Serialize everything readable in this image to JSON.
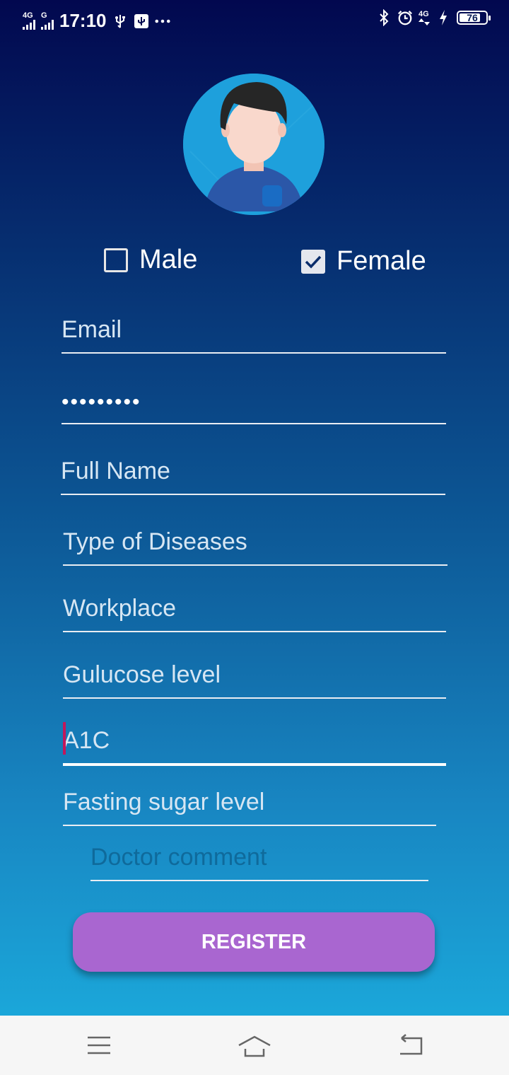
{
  "status_bar": {
    "network1": "4G",
    "network2": "G",
    "time": "17:10",
    "right_network": "4G",
    "battery": "76"
  },
  "form": {
    "gender": {
      "male_label": "Male",
      "female_label": "Female",
      "male_checked": false,
      "female_checked": true
    },
    "email_placeholder": "Email",
    "password_value": "•••••••••",
    "full_name_placeholder": "Full Name",
    "disease_placeholder": "Type of Diseases",
    "workplace_placeholder": "Workplace",
    "glucose_placeholder": "Gulucose level",
    "a1c_placeholder": "A1C",
    "fasting_placeholder": "Fasting sugar level",
    "doctor_comment_placeholder": "Doctor comment",
    "register_label": "REGISTER"
  },
  "colors": {
    "button": "#a966d0",
    "caret": "#c2185b",
    "avatar_bg": "#1ea0dc"
  },
  "icons": {
    "avatar": "user-avatar-icon",
    "nav_menu": "menu-icon",
    "nav_home": "home-icon",
    "nav_back": "back-icon"
  }
}
